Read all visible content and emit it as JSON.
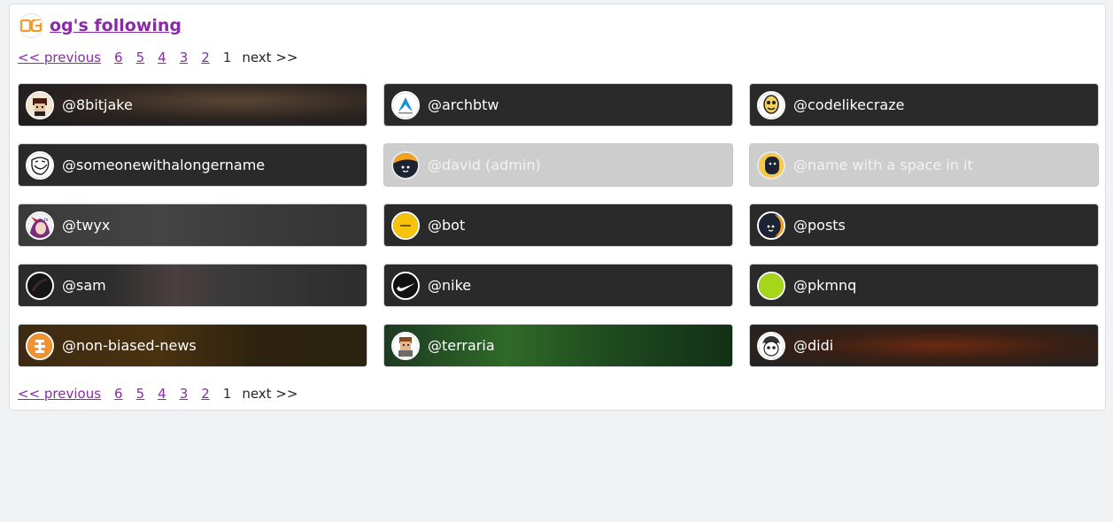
{
  "header": {
    "title": "og's following",
    "logo_icon": "og-logo-icon"
  },
  "pagination": {
    "previous": "<< previous",
    "pages": [
      "6",
      "5",
      "4",
      "3",
      "2"
    ],
    "current": "1",
    "next": "next >>"
  },
  "users": [
    {
      "name": "@8bitjake",
      "icon": "pixel-face-avatar"
    },
    {
      "name": "@archbtw",
      "icon": "arch-linux-avatar"
    },
    {
      "name": "@codelikecraze",
      "icon": "yellow-face-avatar"
    },
    {
      "name": "@someonewithalongername",
      "icon": "troll-face-avatar"
    },
    {
      "name": "@david (admin)",
      "icon": "navy-smile-avatar",
      "disabled": true
    },
    {
      "name": "@name with a space in it",
      "icon": "navy-blob-avatar",
      "disabled": true
    },
    {
      "name": "@twyx",
      "icon": "anime-avatar"
    },
    {
      "name": "@bot",
      "icon": "yellow-bot-avatar"
    },
    {
      "name": "@posts",
      "icon": "navy-moon-avatar"
    },
    {
      "name": "@sam",
      "icon": "dark-avatar"
    },
    {
      "name": "@nike",
      "icon": "nike-swoosh-avatar"
    },
    {
      "name": "@pkmnq",
      "icon": "green-circle-avatar"
    },
    {
      "name": "@non-biased-news",
      "icon": "orange-news-avatar"
    },
    {
      "name": "@terraria",
      "icon": "terraria-guide-avatar"
    },
    {
      "name": "@didi",
      "icon": "cartoon-avatar"
    }
  ],
  "colors": {
    "link": "#8a2aa8",
    "card": "#2a2a2a",
    "card_disabled": "#cdcdcd",
    "page_bg": "#f1f2f4"
  }
}
